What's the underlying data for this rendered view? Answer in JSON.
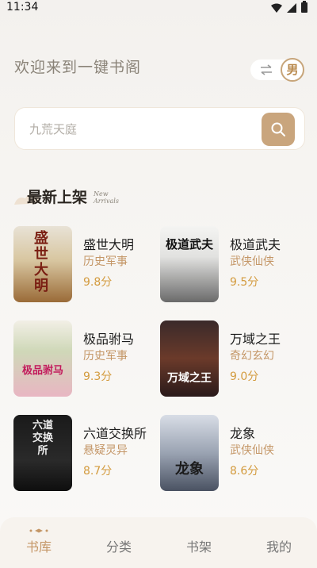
{
  "status": {
    "time": "11:34"
  },
  "header": {
    "welcome": "欢迎来到一键书阁",
    "gender": "男"
  },
  "search": {
    "placeholder": "九荒天庭"
  },
  "section": {
    "title": "最新上架",
    "subtitle_en": "New Arrivals"
  },
  "books": [
    {
      "title": "盛世大明",
      "genre": "历史军事",
      "rating": "9.8分",
      "cover_text": "盛世大明"
    },
    {
      "title": "极道武夫",
      "genre": "武侠仙侠",
      "rating": "9.5分",
      "cover_text": "极道武夫"
    },
    {
      "title": "极品驸马",
      "genre": "历史军事",
      "rating": "9.3分",
      "cover_text": "极品驸马"
    },
    {
      "title": "万域之王",
      "genre": "奇幻玄幻",
      "rating": "9.0分",
      "cover_text": "万域之王"
    },
    {
      "title": "六道交换所",
      "genre": "悬疑灵异",
      "rating": "8.7分",
      "cover_text": "六道交换所"
    },
    {
      "title": "龙象",
      "genre": "武侠仙侠",
      "rating": "8.6分",
      "cover_text": "龙象"
    }
  ],
  "nav": {
    "items": [
      "书库",
      "分类",
      "书架",
      "我的"
    ],
    "active": "书库"
  },
  "colors": {
    "accent": "#c9a57d",
    "rating": "#d39b3e",
    "genre": "#c49666"
  }
}
